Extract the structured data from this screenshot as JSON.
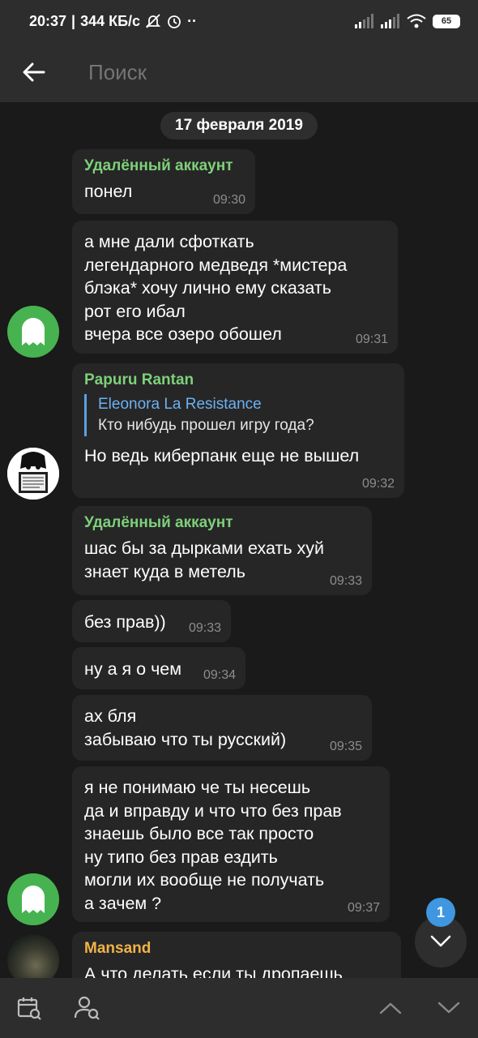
{
  "status_bar": {
    "time": "20:37",
    "speed": "344 КБ/с",
    "battery": "65"
  },
  "app_bar": {
    "search_placeholder": "Поиск"
  },
  "date_separator": "17 февраля 2019",
  "messages": [
    {
      "sender": "Удалённый аккаунт",
      "sender_color": "#7ed07a",
      "text": "понел",
      "time": "09:30"
    },
    {
      "text": "а мне дали сфоткать\nлегендарного медведя *мистера\nблэка* хочу лично ему сказать\nрот его ибал\nвчера все озеро обошел",
      "time": "09:31"
    },
    {
      "sender": "Papuru Rantan",
      "sender_color": "#7ed07a",
      "reply": {
        "name": "Eleonora La Resistance",
        "text": "Кто нибудь прошел игру года?"
      },
      "text": "Но ведь киберпанк еще не вышел",
      "time": "09:32"
    },
    {
      "sender": "Удалённый аккаунт",
      "sender_color": "#7ed07a",
      "text": "шас бы за дырками ехать хуй\nзнает куда в метель",
      "time": "09:33"
    },
    {
      "text": "без прав))",
      "time": "09:33"
    },
    {
      "text": "ну а я о чем",
      "time": "09:34"
    },
    {
      "text": "ах бля\nзабываю что ты русский)",
      "time": "09:35"
    },
    {
      "text": "я не понимаю че ты несешь\nда и вправду и что что без прав\nзнаешь было все так просто\nну типо без прав ездить\nмогли их вообще не получать\nа зачем ?",
      "time": "09:37"
    },
    {
      "sender": "Mansand",
      "sender_color": "#f0b348",
      "text": "А что делать если ты дропаешь"
    }
  ],
  "unread_badge": "1",
  "icons": {
    "back": "arrow-left-icon",
    "ghost_avatar": "ghost-icon",
    "scroll_down": "chevron-down-icon",
    "calendar": "calendar-search-icon",
    "member_search": "user-search-icon",
    "prev": "chevron-up-icon",
    "next": "chevron-down-icon"
  }
}
